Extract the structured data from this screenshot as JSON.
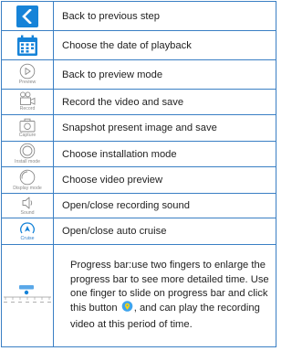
{
  "rows": [
    {
      "icon": "back-arrow-icon",
      "caption": "",
      "text": "Back to previous step"
    },
    {
      "icon": "calendar-icon",
      "caption": "",
      "text": "Choose the date of playback"
    },
    {
      "icon": "preview-icon",
      "caption": "Preview",
      "text": "Back to preview mode"
    },
    {
      "icon": "record-icon",
      "caption": "Record",
      "text": "Record the video and save"
    },
    {
      "icon": "capture-icon",
      "caption": "Capture",
      "text": "Snapshot present image and save"
    },
    {
      "icon": "install-mode-icon",
      "caption": "Install mode",
      "text": "Choose installation mode"
    },
    {
      "icon": "display-mode-icon",
      "caption": "Display mode",
      "text": "Choose video preview"
    },
    {
      "icon": "sound-icon",
      "caption": "Sound",
      "text": "Open/close recording sound"
    },
    {
      "icon": "cruise-icon",
      "caption": "Cruise",
      "text": "Open/close auto cruise"
    }
  ],
  "progress": {
    "text_before": "Progress bar:use two fingers to enlarge the progress bar to see more detailed time. Use one finger to slide on progress bar and click this button ",
    "text_after": ", and can play the recording video at this period of time.",
    "pin_icon": "location-pin-icon"
  },
  "colors": {
    "accent": "#1683d8",
    "border": "#3a7fc4",
    "caption_gray": "#8a8a8a"
  }
}
